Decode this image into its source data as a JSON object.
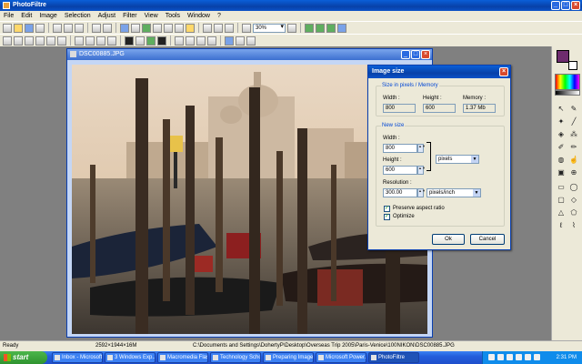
{
  "app": {
    "title": "PhotoFiltre"
  },
  "menu": [
    "File",
    "Edit",
    "Image",
    "Selection",
    "Adjust",
    "Filter",
    "View",
    "Tools",
    "Window",
    "?"
  ],
  "toolbar": {
    "zoom": "30%"
  },
  "document": {
    "title": "DSC00885.JPG"
  },
  "dialog": {
    "title": "Image size",
    "current_group": "Size in pixels / Memory",
    "width_label": "Width :",
    "height_label": "Height :",
    "memory_label": "Memory :",
    "width_value": "800",
    "height_value": "600",
    "memory_value": "1.37 Mb",
    "new_group": "New size",
    "new_width_label": "Width :",
    "new_width": "800",
    "new_height_label": "Height :",
    "new_height": "600",
    "unit": "pixels",
    "resolution_label": "Resolution :",
    "resolution": "300.00",
    "res_unit": "pixels/inch",
    "preserve_label": "Preserve aspect ratio",
    "optimize_label": "Optimize",
    "ok_label": "Ok",
    "cancel_label": "Cancel"
  },
  "status": {
    "ready": "Ready",
    "dims": "2592×1944×16M",
    "path": "C:\\Documents and Settings\\DohertyP\\Desktop\\Overseas Trip 2005\\Paris-Venice\\100NIKON\\DSC00885.JPG"
  },
  "taskbar": {
    "start": "start",
    "tasks": [
      "Inbox - Microsoft...",
      "3 Windows Exp...",
      "Macromedia Flas...",
      "Technology Scho...",
      "Preparing Image...",
      "Microsoft Power...",
      "PhotoFiltre"
    ],
    "clock": "2:31 PM"
  },
  "colors": {
    "foreground": "#6e2c6e",
    "background": "#ffffff",
    "titlebar": "#0a5fd8"
  }
}
